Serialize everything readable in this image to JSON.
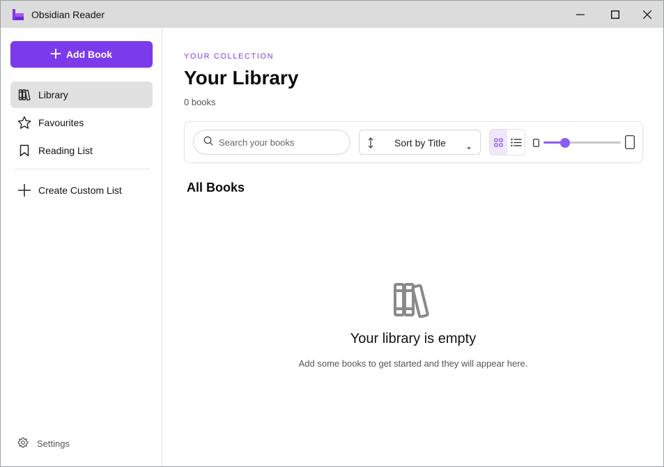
{
  "window": {
    "title": "Obsidian Reader",
    "accent": "#7c3aed"
  },
  "sidebar": {
    "add_button": "Add Book",
    "items": [
      {
        "label": "Library",
        "icon": "library-icon",
        "active": true
      },
      {
        "label": "Favourites",
        "icon": "star-icon",
        "active": false
      },
      {
        "label": "Reading List",
        "icon": "bookmark-icon",
        "active": false
      }
    ],
    "create_list": "Create Custom List",
    "settings": "Settings"
  },
  "main": {
    "eyebrow": "YOUR COLLECTION",
    "title": "Your Library",
    "count": "0 books",
    "search_placeholder": "Search your books",
    "sort_label": "Sort by Title",
    "view_mode": "grid",
    "size_slider_value": 0.28,
    "section_title": "All Books",
    "empty_title": "Your library is empty",
    "empty_subtitle": "Add some books to get started and they will appear here."
  }
}
